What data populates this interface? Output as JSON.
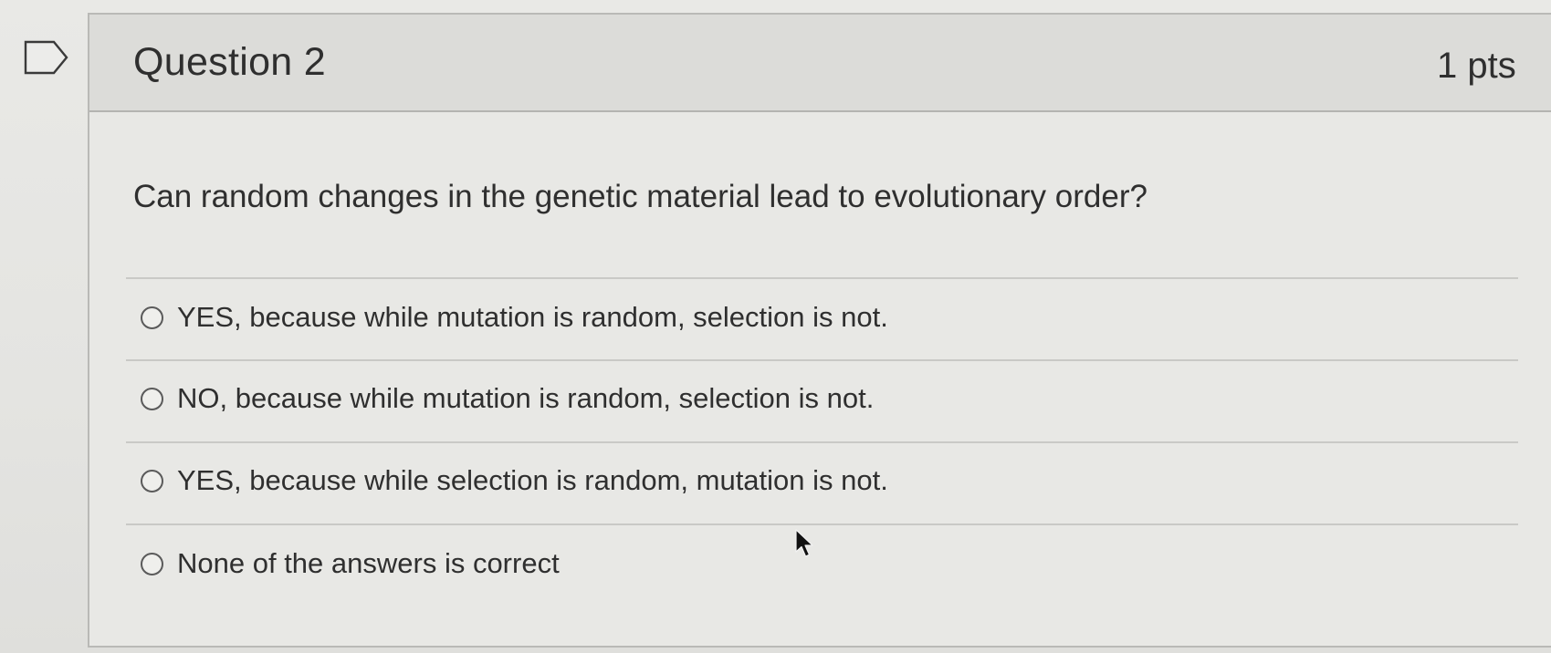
{
  "question": {
    "title": "Question 2",
    "points": "1 pts",
    "text": "Can random changes in the genetic material lead to evolutionary order?"
  },
  "answers": [
    {
      "label": "YES, because while mutation is random, selection is not.",
      "selected": false
    },
    {
      "label": "NO, because while mutation is random, selection is not.",
      "selected": false
    },
    {
      "label": "YES, because while selection is random, mutation is not.",
      "selected": false
    },
    {
      "label": "None of the answers is correct",
      "selected": false
    }
  ],
  "icons": {
    "flag": "flag-question-icon",
    "cursor": "mouse-pointer-icon"
  },
  "colors": {
    "text": "#2f2f2f",
    "header_background": "#dcdcd9",
    "background": "#e8e8e5"
  }
}
